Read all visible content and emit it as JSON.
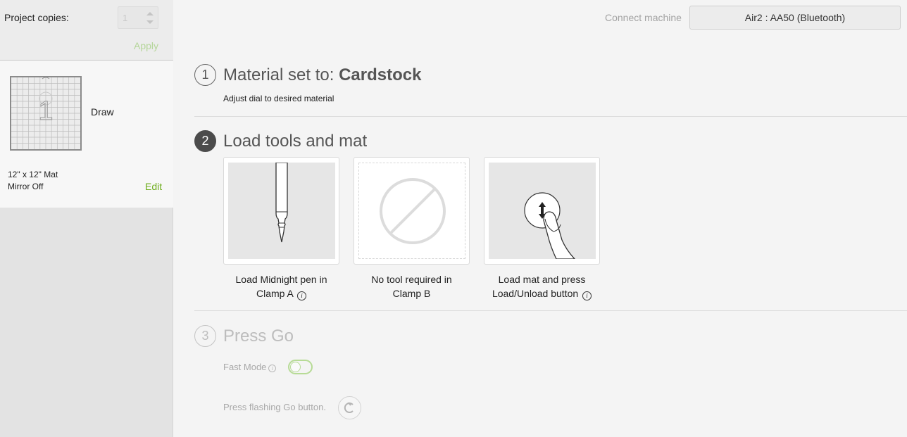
{
  "sidebar": {
    "copies_label": "Project copies:",
    "copies_value": "1",
    "apply_label": "Apply",
    "mat": {
      "number": "1",
      "operation": "Draw",
      "size": "12\" x 12\" Mat",
      "mirror": "Mirror Off",
      "edit_label": "Edit"
    }
  },
  "header": {
    "connect_label": "Connect machine",
    "machine": "Air2 : AA50 (Bluetooth)"
  },
  "steps": {
    "step1": {
      "number": "1",
      "title_prefix": "Material set to: ",
      "material": "Cardstock",
      "subtitle": "Adjust dial to desired material"
    },
    "step2": {
      "number": "2",
      "title": "Load tools and mat",
      "cards": [
        {
          "line1": "Load Midnight pen in",
          "line2": "Clamp A",
          "icon": "pen-illustration"
        },
        {
          "line1": "No tool required in",
          "line2": "Clamp B",
          "icon": "no-tool-icon"
        },
        {
          "line1": "Load mat and press",
          "line2": "Load/Unload button",
          "icon": "press-button-illustration"
        }
      ]
    },
    "step3": {
      "number": "3",
      "title": "Press Go",
      "fast_mode_label": "Fast Mode",
      "go_label": "Press flashing Go button."
    }
  },
  "colors": {
    "accent_green": "#6fae1e",
    "disabled_green": "#b5d69a",
    "step_dark": "#4b4b4b"
  }
}
